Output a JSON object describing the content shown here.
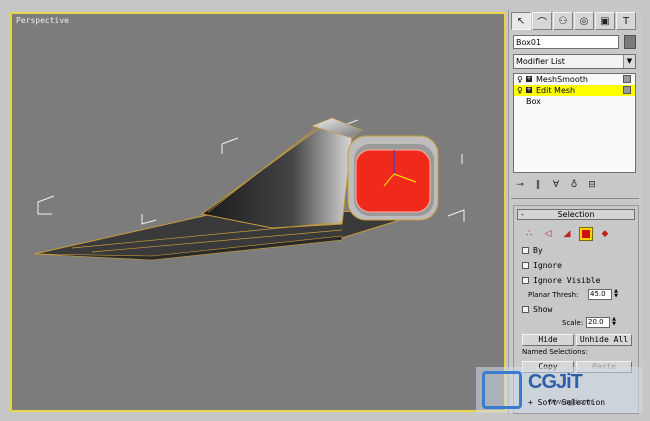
{
  "viewport": {
    "label": "Perspective",
    "border_color": "#e8d24a",
    "background": "#7c7c7c"
  },
  "command_panel": {
    "tabs": [
      {
        "icon": "pointer-icon"
      },
      {
        "icon": "curve-icon"
      },
      {
        "icon": "hierarchy-icon"
      },
      {
        "icon": "motion-icon"
      },
      {
        "icon": "display-icon"
      },
      {
        "icon": "utilities-icon"
      }
    ],
    "object_name": "Box01",
    "modifier_list": "Modifier List",
    "stack": [
      {
        "label": "MeshSmooth",
        "selected": false
      },
      {
        "label": "Edit Mesh",
        "selected": true
      },
      {
        "label": "Box",
        "selected": false
      }
    ],
    "selection_rollout": {
      "title": "Selection",
      "by_vertex": "By",
      "ignore_backfaces": "Ignore",
      "ignore_visible": "Ignore Visible",
      "planar_thresh_label": "Planar Thresh:",
      "planar_thresh_value": "45.0",
      "show_normals": "Show",
      "scale_label": "Scale:",
      "scale_value": "20.0",
      "hide": "Hide",
      "unhide_all": "Unhide All",
      "named_selections": "Named Selections:",
      "copy": "Copy",
      "paste": "Paste"
    },
    "soft_selection": "Soft Selection",
    "accent_color": "#ffff00"
  },
  "watermark": {
    "brand": "CGJiT",
    "url": "www.cgjit.com"
  }
}
